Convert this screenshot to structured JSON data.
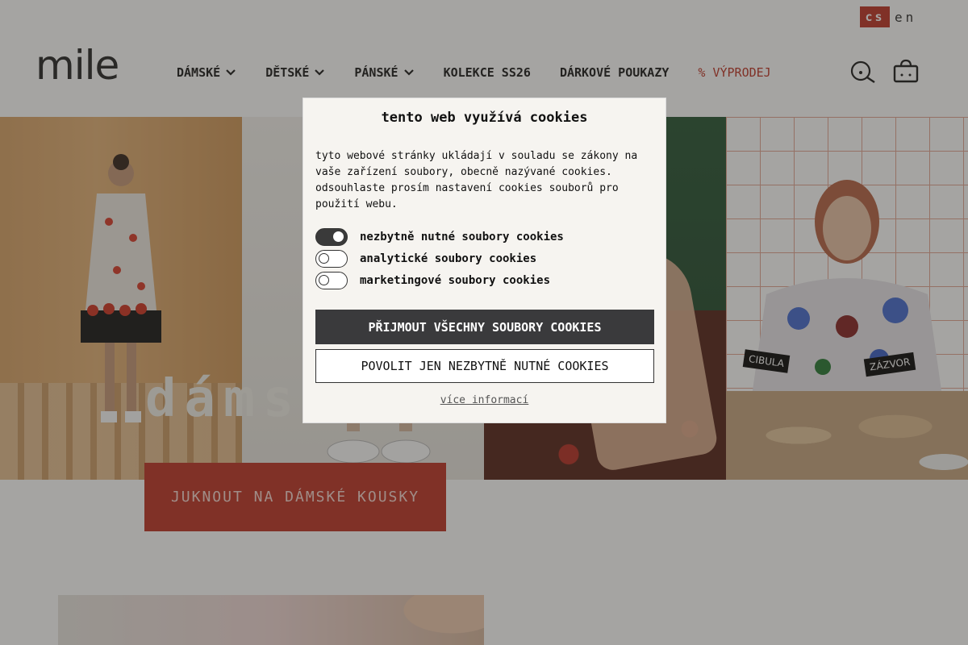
{
  "lang": {
    "active": "cs",
    "other": "en"
  },
  "brand": {
    "logo": "mile"
  },
  "nav": {
    "items": [
      {
        "label": "DÁMSKÉ",
        "has_dropdown": true
      },
      {
        "label": "DĚTSKÉ",
        "has_dropdown": true
      },
      {
        "label": "PÁNSKÉ",
        "has_dropdown": true
      },
      {
        "label": "KOLEKCE SS26",
        "has_dropdown": false
      },
      {
        "label": "DÁRKOVÉ POUKAZY",
        "has_dropdown": false
      },
      {
        "label": "% VÝPRODEJ",
        "has_dropdown": false
      }
    ],
    "icons": [
      "search-icon",
      "cart-icon"
    ]
  },
  "hero": {
    "title": "dáms",
    "signs": [
      "CIBULA",
      "ZÁZVOR"
    ],
    "cta": "JUKNOUT NA DÁMSKÉ KOUSKY"
  },
  "cookie": {
    "title": "tento web využívá cookies",
    "text": "tyto webové stránky ukládají v souladu se zákony na vaše zařízení soubory, obecně nazývané cookies. odsouhlaste prosím nastavení cookies souborů pro použití webu.",
    "options": [
      {
        "label": "nezbytně nutné soubory cookies",
        "checked": true
      },
      {
        "label": "analytické soubory cookies",
        "checked": false
      },
      {
        "label": "marketingové soubory cookies",
        "checked": false
      }
    ],
    "accept_all": "PŘIJMOUT VŠECHNY SOUBORY COOKIES",
    "accept_necessary": "POVOLIT JEN NEZBYTNĚ NUTNÉ COOKIES",
    "more_info": "více informací"
  },
  "colors": {
    "accent": "#c0392b",
    "dark_button": "#3a3a3c",
    "dialog_bg": "#f6f4f0"
  }
}
